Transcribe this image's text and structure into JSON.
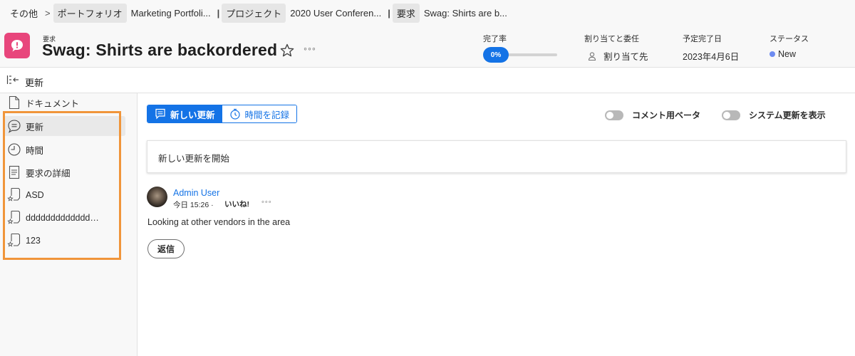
{
  "breadcrumb": {
    "items": [
      "その他",
      "ポートフォリオ",
      "Marketing Portfoli...",
      "プロジェクト",
      "2020 User Conferen...",
      "要求",
      "Swag: Shirts are b..."
    ],
    "separator": ">"
  },
  "header": {
    "type_label": "要求",
    "title": "Swag: Shirts are backordered",
    "progress_label": "完了率",
    "progress_value": "0%",
    "progress_fraction": 0,
    "assign_label": "割り当てと委任",
    "assign_value": "割り当て先",
    "due_label": "予定完了日",
    "due_value": "2023年4月6日",
    "status_label": "ステータス",
    "status_value": "New",
    "more": "◦◦◦"
  },
  "subbar": {
    "label": "更新"
  },
  "nav": {
    "items": [
      {
        "label": "ドキュメント",
        "icon": "document-icon"
      },
      {
        "label": "更新",
        "icon": "comment-icon"
      },
      {
        "label": "時間",
        "icon": "clock-icon"
      },
      {
        "label": "要求の詳細",
        "icon": "details-icon"
      },
      {
        "label": "ASD",
        "icon": "custom-form-icon"
      },
      {
        "label": "ddddddddddddd…",
        "icon": "custom-form-icon"
      },
      {
        "label": "123",
        "icon": "custom-form-icon"
      }
    ]
  },
  "main": {
    "tab_new_update": "新しい更新",
    "tab_log_time": "時間を記録",
    "toggle_comment_beta": "コメント用ベータ",
    "toggle_system_updates": "システム更新を表示",
    "composer_placeholder": "新しい更新を開始",
    "post": {
      "author": "Admin User",
      "time": "今日 15:26 ·",
      "like": "いいね!",
      "more": "◦◦◦",
      "body": "Looking at other vendors in the area",
      "reply": "返信"
    }
  },
  "colors": {
    "accent": "#1473e6",
    "brand_icon": "#e8467c",
    "status_dot": "#6d8bf0",
    "highlight": "#f0953a"
  }
}
